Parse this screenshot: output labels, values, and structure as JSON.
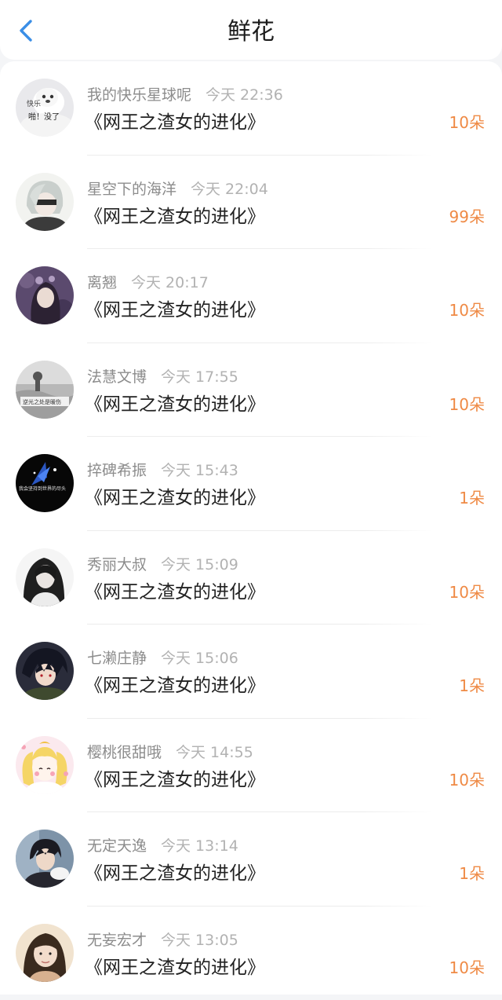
{
  "header": {
    "title": "鲜花",
    "back_icon": "chevron-left-icon",
    "accent": "#3a8ee6"
  },
  "amount_color": "#ef8a45",
  "items": [
    {
      "user": "我的快乐星球呢",
      "time": "今天 22:36",
      "book": "《网王之渣女的进化》",
      "amount": "10朵",
      "avatar_text_1": "快乐",
      "avatar_text_2": "啪！没了"
    },
    {
      "user": "星空下的海洋",
      "time": "今天 22:04",
      "book": "《网王之渣女的进化》",
      "amount": "99朵"
    },
    {
      "user": "离翘",
      "time": "今天 20:17",
      "book": "《网王之渣女的进化》",
      "amount": "10朵"
    },
    {
      "user": "法慧文博",
      "time": "今天 17:55",
      "book": "《网王之渣女的进化》",
      "amount": "10朵",
      "avatar_text_1": "逆光之处是暖伤"
    },
    {
      "user": "捽碑希振",
      "time": "今天 15:43",
      "book": "《网王之渣女的进化》",
      "amount": "1朵",
      "avatar_text_1": "我会坚持到世界的尽头"
    },
    {
      "user": "秀丽大叔",
      "time": "今天 15:09",
      "book": "《网王之渣女的进化》",
      "amount": "10朵"
    },
    {
      "user": "七濑庄静",
      "time": "今天 15:06",
      "book": "《网王之渣女的进化》",
      "amount": "1朵"
    },
    {
      "user": "樱桃很甜哦",
      "time": "今天 14:55",
      "book": "《网王之渣女的进化》",
      "amount": "10朵"
    },
    {
      "user": "无定天逸",
      "time": "今天 13:14",
      "book": "《网王之渣女的进化》",
      "amount": "1朵"
    },
    {
      "user": "无妄宏才",
      "time": "今天 13:05",
      "book": "《网王之渣女的进化》",
      "amount": "10朵"
    }
  ]
}
